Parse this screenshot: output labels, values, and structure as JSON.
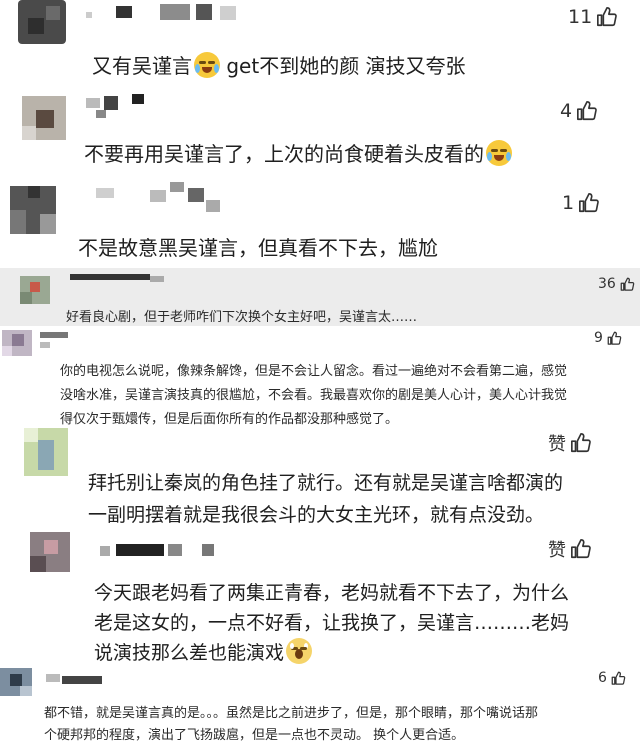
{
  "comments": [
    {
      "text": "又有吴谨言",
      "text2": "get不到她的颜 演技又夸张",
      "likes": "11"
    },
    {
      "text": "不要再用吴谨言了，上次的尚食硬着头皮看的",
      "likes": "4"
    },
    {
      "text": "不是故意黑吴谨言，但真看不下去，尴尬",
      "likes": "1"
    },
    {
      "text": "好看良心剧，但于老师咋们下次换个女主好吧，吴谨言太……",
      "likes": "36"
    },
    {
      "lines": [
        "你的电视怎么说呢，像辣条解馋，但是不会让人留念。看过一遍绝对不会看第二遍，感觉",
        "没啥水准，吴谨言演技真的很尴尬，不会看。我最喜欢你的剧是美人心计，美人心计我觉",
        "得仅次于甄嬛传，但是后面你所有的作品都没那种感觉了。"
      ],
      "likes": "9"
    },
    {
      "lines": [
        "拜托别让秦岚的角色挂了就行。还有就是吴谨言啥都演的",
        "一副明摆着就是我很会斗的大女主光环，就有点没劲。"
      ],
      "likes": "赞"
    },
    {
      "lines": [
        "今天跟老妈看了两集正青春，老妈就看不下去了，为什么",
        "老是这女的，一点不好看，让我换了，吴谨言………老妈",
        "说演技那么差也能演戏"
      ],
      "likes": "赞"
    },
    {
      "lines": [
        "都不错，就是吴谨言真的是。。。虽然是比之前进步了，但是，那个眼睛，那个嘴说话那",
        "个硬邦邦的程度，演出了飞扬跋扈，但是一点也不灵动。 换个人更合适。"
      ],
      "likes": "6"
    }
  ]
}
